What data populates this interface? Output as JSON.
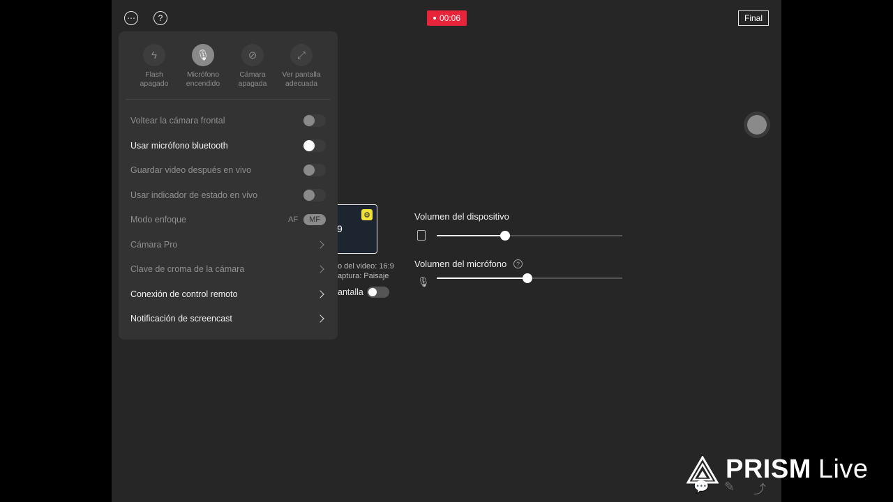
{
  "top": {
    "more_icon": "ellipsis-icon",
    "help_icon": "question-icon",
    "recording_time": "00:06",
    "final_button": "Final"
  },
  "colors": {
    "record": "#e8243a",
    "badge": "#f1e23a",
    "stage": "#262626",
    "panel": "#333333"
  },
  "preview": {
    "number": "9",
    "info_line1": "o del video: 16:9",
    "info_line2": "aptura: Paisaje",
    "toggle_label": "antalla",
    "toggle_on": false
  },
  "volume": {
    "device_title": "Volumen del dispositivo",
    "device_level": 0.37,
    "mic_title": "Volumen del micrófono",
    "mic_level": 0.49
  },
  "panel": {
    "quick_actions": [
      {
        "label_1": "Flash",
        "label_2": "apagado",
        "icon": "flash-off-icon",
        "active": false
      },
      {
        "label_1": "Micrófono",
        "label_2": "encendido",
        "icon": "microphone-icon",
        "active": true
      },
      {
        "label_1": "Cámara",
        "label_2": "apagada",
        "icon": "camera-off-icon",
        "active": false
      },
      {
        "label_1": "Ver pantalla",
        "label_2": "adecuada",
        "icon": "fit-screen-icon",
        "active": false
      }
    ],
    "rows": [
      {
        "label": "Voltear la cámara frontal",
        "type": "toggle",
        "on": false,
        "enabled": false
      },
      {
        "label": "Usar micrófono bluetooth",
        "type": "toggle",
        "on": false,
        "enabled": true
      },
      {
        "label": "Guardar video después en vivo",
        "type": "toggle",
        "on": false,
        "enabled": false
      },
      {
        "label": "Usar indicador de estado en vivo",
        "type": "toggle",
        "on": false,
        "enabled": false
      },
      {
        "label": "Modo enfoque",
        "type": "segmented",
        "options": [
          "AF",
          "MF"
        ],
        "selected": "MF",
        "enabled": false
      },
      {
        "label": "Cámara Pro",
        "type": "link",
        "enabled": false
      },
      {
        "label": "Clave de croma de la cámara",
        "type": "link",
        "enabled": false
      },
      {
        "label": "Conexión de control remoto",
        "type": "link",
        "enabled": true
      },
      {
        "label": "Notificación de screencast",
        "type": "link",
        "enabled": true
      }
    ]
  },
  "watermark": {
    "brand": "PRISM",
    "suffix": "Live"
  },
  "bottom_icons": [
    "chat-icon",
    "pen-icon",
    "share-icon"
  ]
}
